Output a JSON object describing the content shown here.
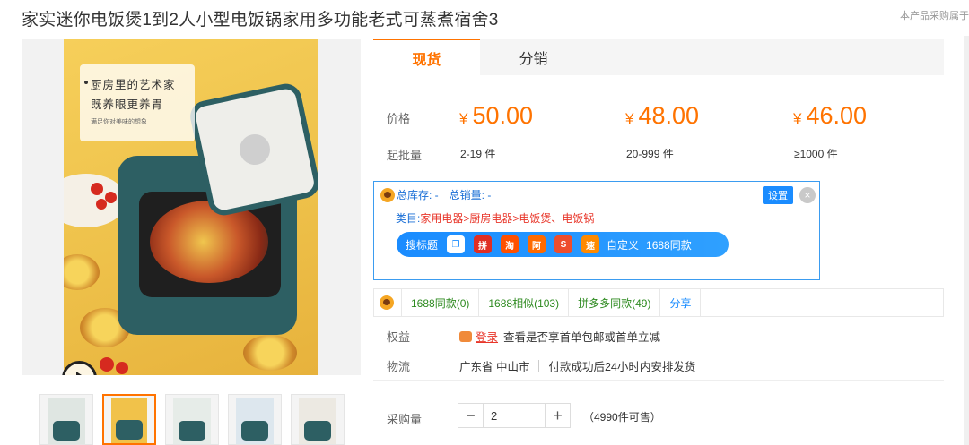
{
  "product": {
    "title": "家实迷你电饭煲1到2人小型电饭锅家用多功能老式可蒸煮宿舍3",
    "note": "本产品采购属于"
  },
  "gallery": {
    "banner_line1": "厨房里的艺术家",
    "banner_line2": "既养眼更养胃",
    "banner_line3": "满足你对美味的想象",
    "thumbnail_count": 5,
    "active_thumbnail": 1
  },
  "tabs": [
    {
      "label": "现货",
      "active": true
    },
    {
      "label": "分销",
      "active": false
    }
  ],
  "pricing": {
    "price_label": "价格",
    "moq_label": "起批量",
    "currency": "¥",
    "tiers": [
      {
        "price": "50.00",
        "range": "2-19 件"
      },
      {
        "price": "48.00",
        "range": "20-999 件"
      },
      {
        "price": "46.00",
        "range": "≥1000 件"
      }
    ]
  },
  "plugin": {
    "total_stock": "总库存: -",
    "total_sales": "总销量: -",
    "settings_label": "设置",
    "close_symbol": "×",
    "category_key": "类目:",
    "category_value": "家用电器>厨房电器>电饭煲、电饭锅",
    "search_title_label": "搜标题",
    "custom_label": "自定义",
    "same_1688_label": "1688同款",
    "toolbar_icons": [
      {
        "name": "copy-icon",
        "text": "❐",
        "color": "#1a8cff"
      },
      {
        "name": "pinduoduo-icon",
        "text": "拼",
        "color": "#e02e24"
      },
      {
        "name": "taobao-icon",
        "text": "淘",
        "color": "#ff5000"
      },
      {
        "name": "alibaba-icon",
        "text": "阿",
        "color": "#ff6a00"
      },
      {
        "name": "shopee-icon",
        "text": "S",
        "color": "#ee4d2d"
      },
      {
        "name": "global-icon",
        "text": "速",
        "color": "#ff8a00"
      }
    ]
  },
  "links": {
    "same_1688": "1688同款(0)",
    "similar_1688": "1688相似(103)",
    "pdd_same": "拼多多同款(49)",
    "share": "分享"
  },
  "rights": {
    "label": "权益",
    "badge": "登录",
    "text": "查看是否享首单包邮或首单立减"
  },
  "logistics": {
    "label": "物流",
    "location": "广东省 中山市",
    "shipping": "付款成功后24小时内安排发货"
  },
  "purchase": {
    "label": "采购量",
    "quantity": "2",
    "minus": "−",
    "plus": "+",
    "stock": "（4990件可售）"
  },
  "colors": {
    "accent": "#ff7300",
    "plugin_blue": "#1a8cff",
    "link_green": "#2d8a1f",
    "category_red": "#e8362a"
  }
}
